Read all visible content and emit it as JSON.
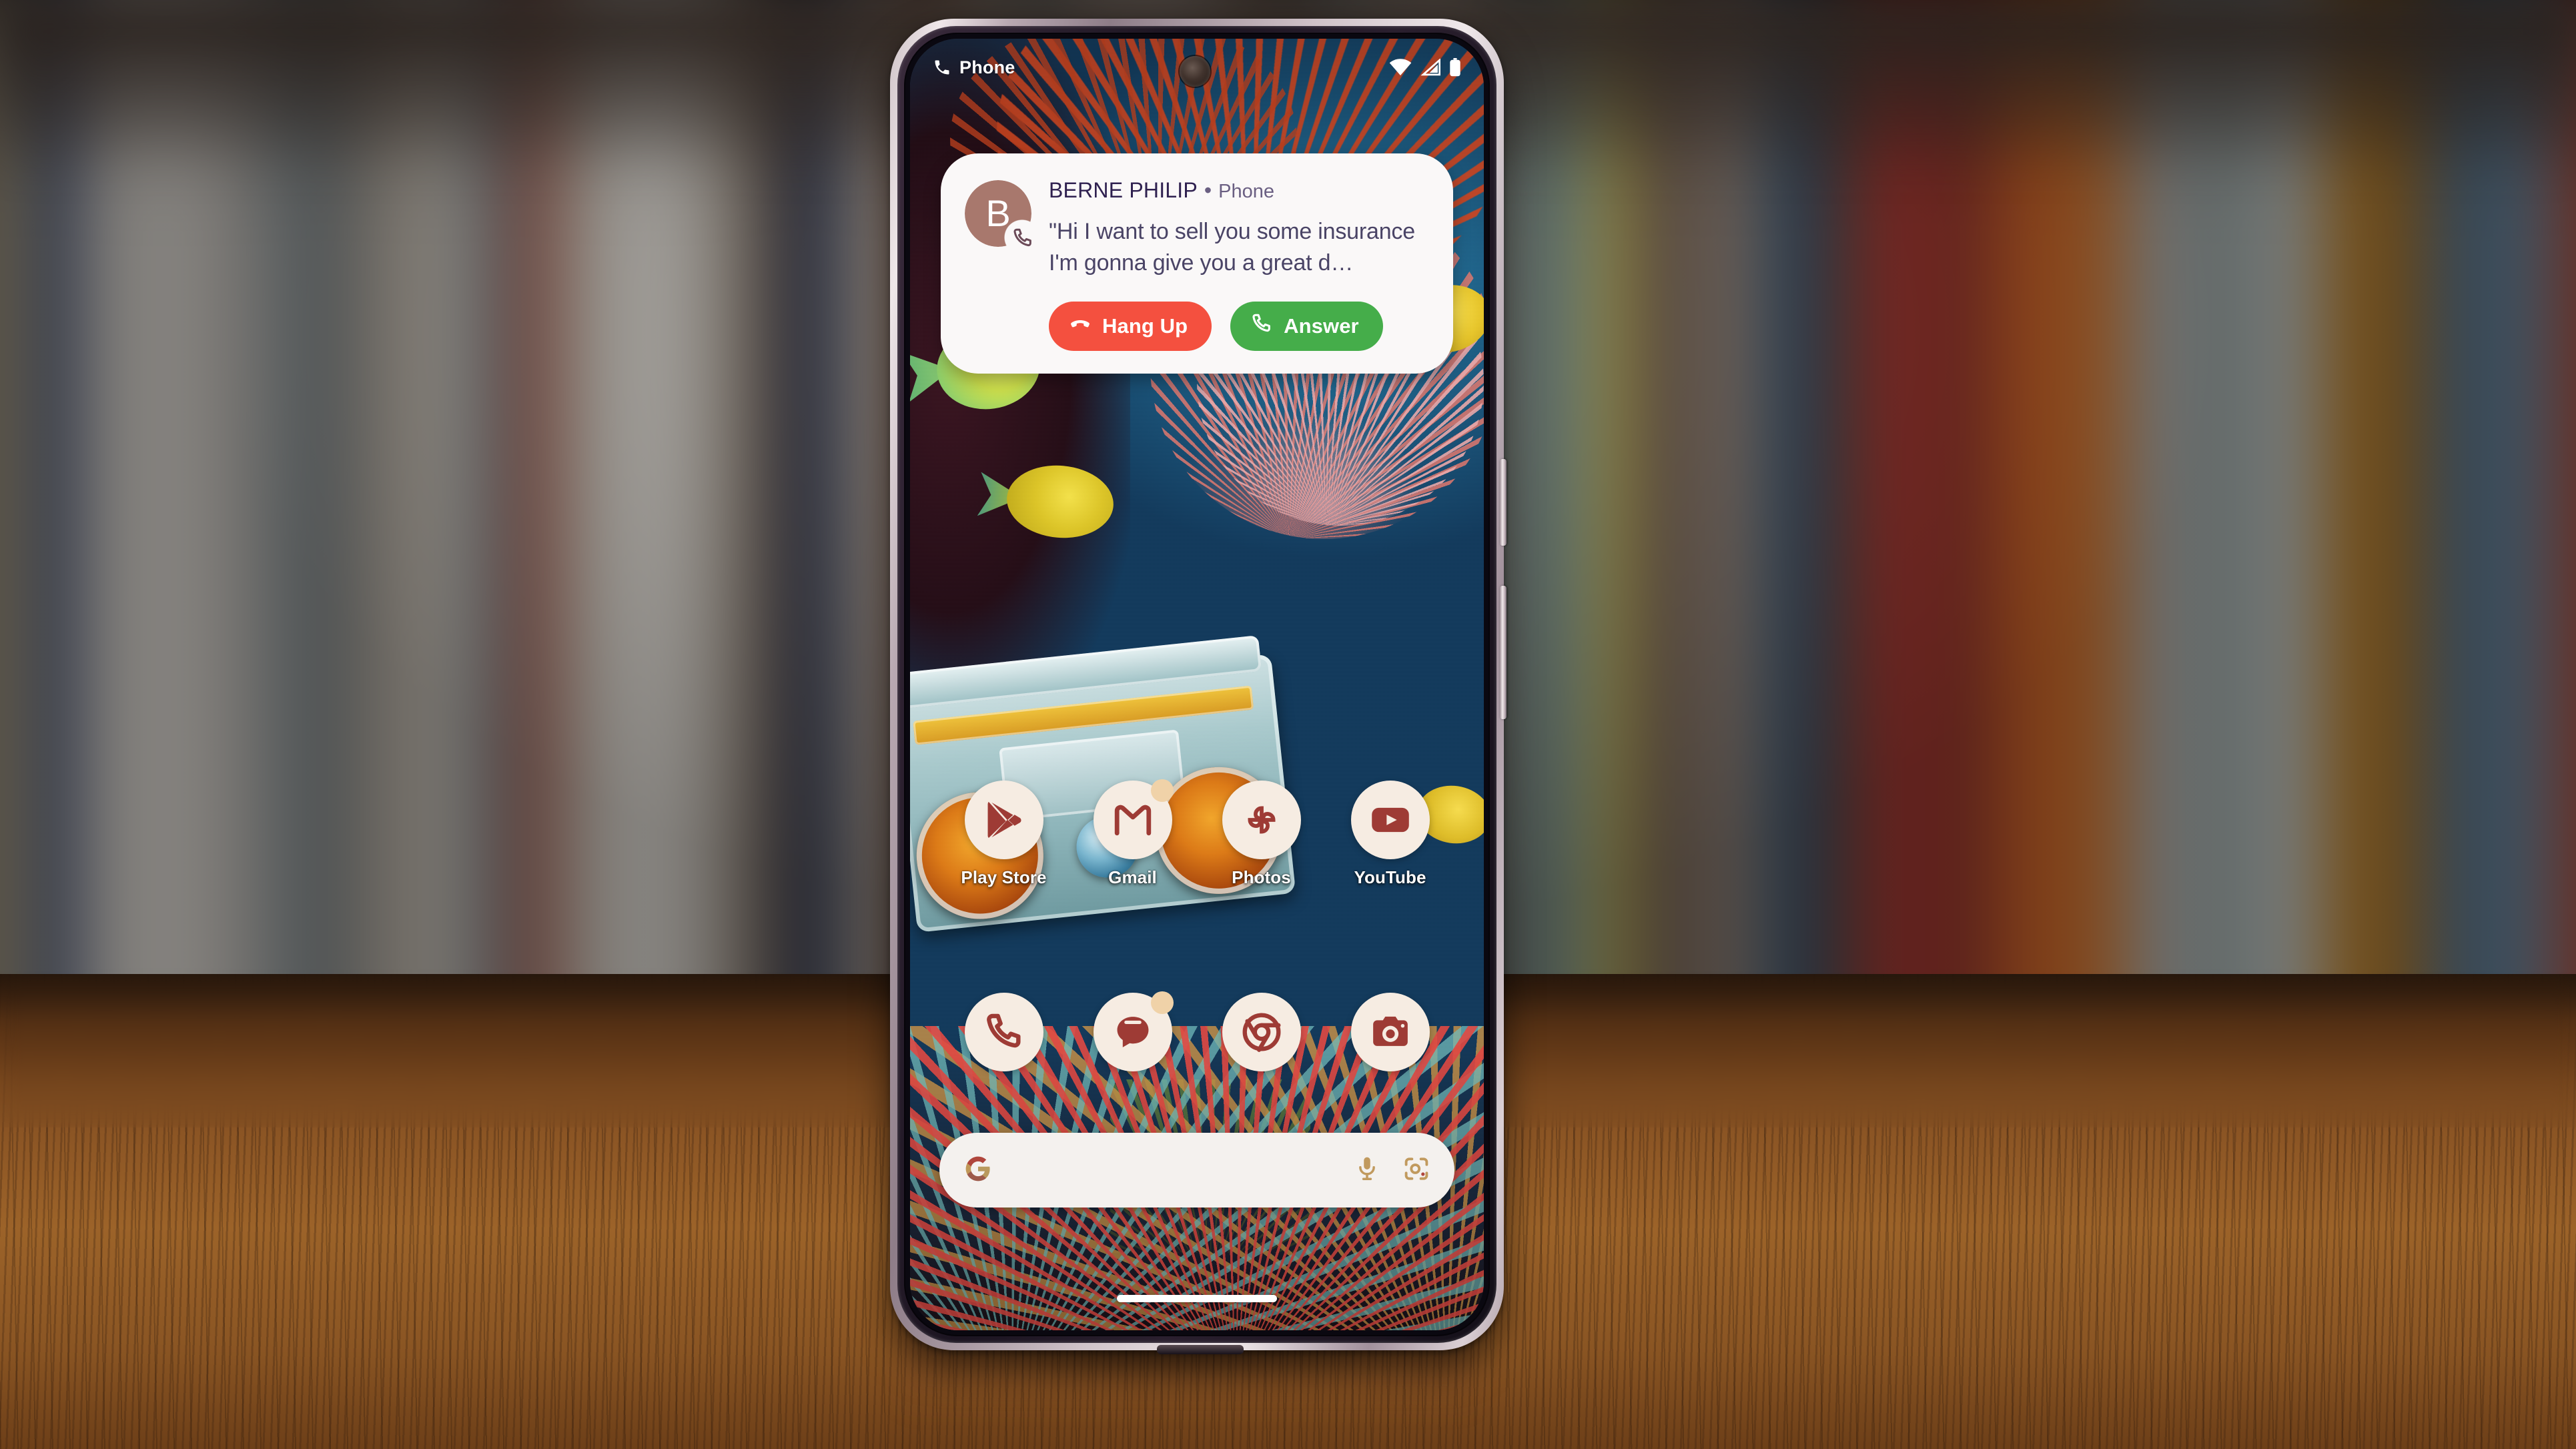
{
  "status_bar": {
    "app_label": "Phone",
    "phone_icon": "phone-icon",
    "wifi_icon": "wifi-icon",
    "signal_icon": "cellular-signal-icon",
    "battery_icon": "battery-icon"
  },
  "notification": {
    "avatar_initial": "B",
    "avatar_color": "#a8786d",
    "caller_name": "BERNE PHILIP",
    "separator": "•",
    "source_app": "Phone",
    "transcript": "\"Hi I want to sell you some insurance I'm gonna give you a great d…",
    "hang_up_label": "Hang Up",
    "answer_label": "Answer",
    "hang_up_color": "#f4503f",
    "answer_color": "#45ad4a"
  },
  "home_screen": {
    "apps": [
      {
        "label": "Play Store",
        "icon": "play-store-icon",
        "badge": false
      },
      {
        "label": "Gmail",
        "icon": "gmail-icon",
        "badge": true
      },
      {
        "label": "Photos",
        "icon": "google-photos-icon",
        "badge": false
      },
      {
        "label": "YouTube",
        "icon": "youtube-icon",
        "badge": false
      }
    ],
    "dock": [
      {
        "label": "Phone",
        "icon": "phone-icon",
        "badge": false
      },
      {
        "label": "Messages",
        "icon": "messages-icon",
        "badge": true
      },
      {
        "label": "Chrome",
        "icon": "chrome-icon",
        "badge": false
      },
      {
        "label": "Camera",
        "icon": "camera-icon",
        "badge": false
      }
    ],
    "icon_bg_color": "#f6ece2",
    "icon_glyph_color": "#9e3b35"
  },
  "search": {
    "google_icon": "google-g-icon",
    "value": "",
    "placeholder": "",
    "mic_icon": "microphone-icon",
    "lens_icon": "google-lens-icon"
  },
  "system": {
    "gesture_bar": "home-gesture-bar"
  }
}
